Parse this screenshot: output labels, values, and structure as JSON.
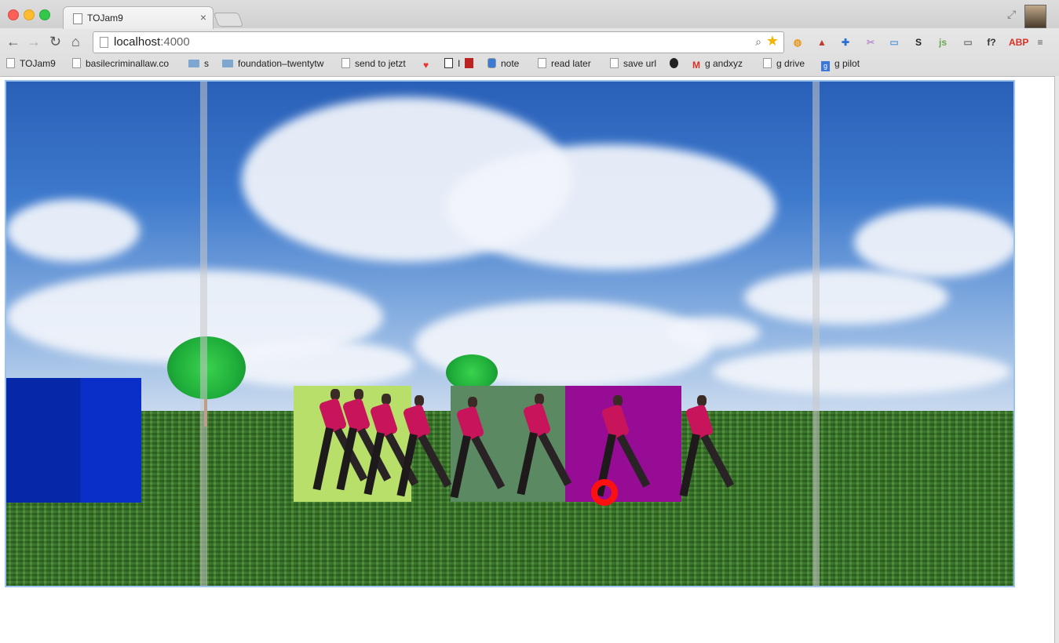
{
  "window": {
    "tab_title": "TOJam9",
    "tab_close": "×"
  },
  "toolbar": {
    "back": "←",
    "forward": "→",
    "reload": "↻",
    "home": "⌂",
    "url_host": "localhost",
    "url_port": ":4000",
    "zoom_icon": "⌕",
    "star_icon": "★"
  },
  "extensions": [
    {
      "name": "ring-extension-icon",
      "glyph": "◍",
      "color": "#e59a1a"
    },
    {
      "name": "red-chair-extension-icon",
      "glyph": "▲",
      "color": "#c0392b"
    },
    {
      "name": "blue-compass-extension-icon",
      "glyph": "✚",
      "color": "#2a6fcf"
    },
    {
      "name": "scissors-extension-icon",
      "glyph": "✂",
      "color": "#b88fce"
    },
    {
      "name": "window-extension-icon",
      "glyph": "▭",
      "color": "#5e9ad6"
    },
    {
      "name": "s-extension-icon",
      "glyph": "S",
      "color": "#222222"
    },
    {
      "name": "js-extension-icon",
      "glyph": "js",
      "color": "#6aa84f"
    },
    {
      "name": "cast-icon",
      "glyph": "▭",
      "color": "#777777"
    },
    {
      "name": "fx-extension-icon",
      "glyph": "f?",
      "color": "#333333"
    },
    {
      "name": "adblock-icon",
      "glyph": "ABP",
      "color": "#d93025"
    },
    {
      "name": "menu-icon",
      "glyph": "≡",
      "color": "#555555"
    }
  ],
  "bookmarks": [
    {
      "label": "TOJam9",
      "type": "page"
    },
    {
      "label": "basilecriminallaw.co",
      "type": "page"
    },
    {
      "label": "s",
      "type": "folder"
    },
    {
      "label": "foundation–twentytw",
      "type": "folder"
    },
    {
      "label": "send to jetzt",
      "type": "page"
    },
    {
      "label": "",
      "type": "heart"
    },
    {
      "label": "I",
      "type": "instapaper"
    },
    {
      "label": "",
      "type": "red"
    },
    {
      "label": "note",
      "type": "note"
    },
    {
      "label": "read later",
      "type": "page"
    },
    {
      "label": "save url",
      "type": "page"
    },
    {
      "label": "",
      "type": "github"
    },
    {
      "label": "g andxyz",
      "type": "gmail"
    },
    {
      "label": "g drive",
      "type": "page"
    },
    {
      "label": "g pilot",
      "type": "google"
    }
  ],
  "game": {
    "blocks": [
      {
        "name": "blue-block",
        "color": "#0a2fc0"
      },
      {
        "name": "lime-block",
        "color": "#b8df6a"
      },
      {
        "name": "sage-block",
        "color": "#5b8a62"
      },
      {
        "name": "purple-block",
        "color": "#970c95"
      }
    ],
    "ring_color": "#ff1010"
  }
}
